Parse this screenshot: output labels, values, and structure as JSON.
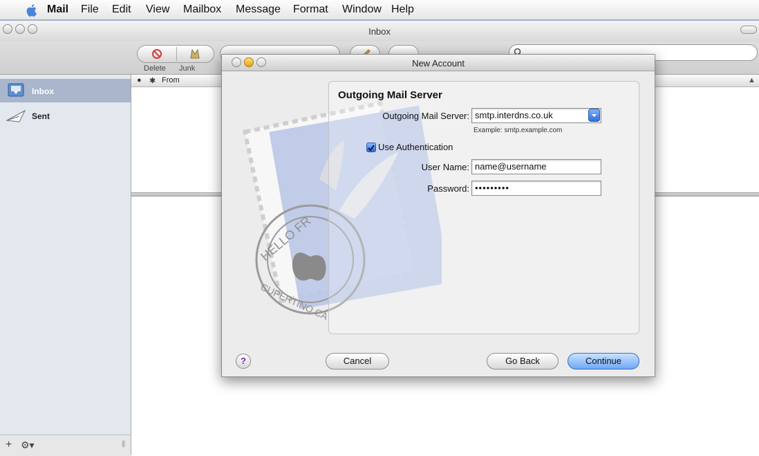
{
  "menubar": {
    "app": "Mail",
    "items": [
      "File",
      "Edit",
      "View",
      "Mailbox",
      "Message",
      "Format",
      "Window",
      "Help"
    ]
  },
  "window": {
    "title": "Inbox",
    "toolbar": {
      "delete_label": "Delete",
      "junk_label": "Junk"
    }
  },
  "sidebar": {
    "items": [
      {
        "label": "Inbox"
      },
      {
        "label": "Sent"
      }
    ]
  },
  "message_list": {
    "from_header": "From"
  },
  "dialog": {
    "title": "New Account",
    "section_title": "Outgoing Mail Server",
    "outgoing_label": "Outgoing Mail Server:",
    "outgoing_value": "smtp.interdns.co.uk",
    "hint": "Example: smtp.example.com",
    "auth_label": "Use Authentication",
    "auth_checked": true,
    "username_label": "User Name:",
    "username_value": "name@username",
    "password_label": "Password:",
    "password_value": "•••••••••",
    "cancel_label": "Cancel",
    "goback_label": "Go Back",
    "continue_label": "Continue",
    "help_label": "?",
    "stamp_text_top": "HELLO FR",
    "stamp_text_bottom": "CUPERTINO CA"
  },
  "colors": {
    "accent": "#3a7bd5",
    "sidebar_selection": "#a9b6cc"
  }
}
